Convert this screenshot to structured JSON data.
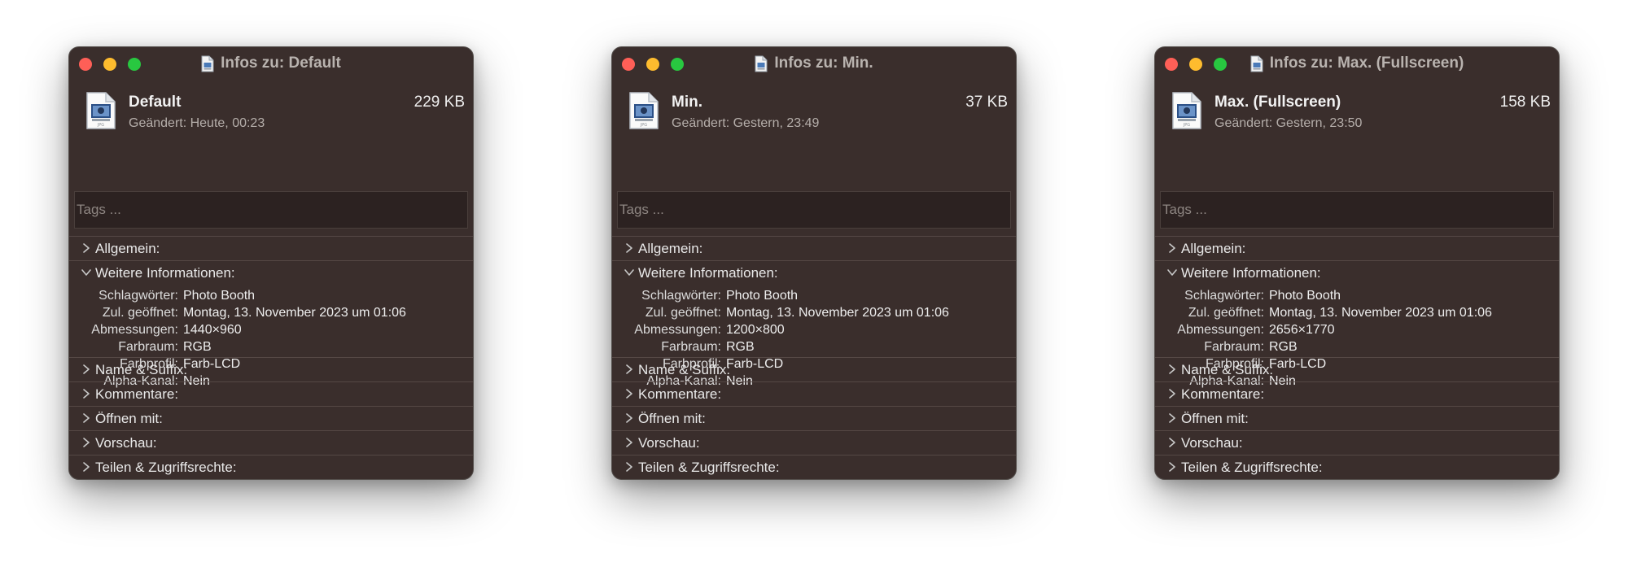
{
  "windows": [
    {
      "title": "Infos zu: Default",
      "file_name": "Default",
      "file_size": "229 KB",
      "modified": "Geändert: Heute, 00:23",
      "icon_caption": "JPG",
      "tags_placeholder": "Tags ...",
      "sections": {
        "general": "Allgemein:",
        "more_info": "Weitere Informationen:",
        "name_suffix": "Name & Suffix:",
        "comments": "Kommentare:",
        "open_with": "Öffnen mit:",
        "preview": "Vorschau:",
        "sharing": "Teilen & Zugriffsrechte:"
      },
      "details": [
        {
          "label": "Schlagwörter:",
          "value": "Photo Booth"
        },
        {
          "label": "Zul. geöffnet:",
          "value": "Montag, 13. November 2023 um 01:06"
        },
        {
          "label": "Abmessungen:",
          "value": "1440×960"
        },
        {
          "label": "Farbraum:",
          "value": "RGB"
        },
        {
          "label": "Farbprofil:",
          "value": "Farb-LCD"
        },
        {
          "label": "Alpha-Kanal:",
          "value": "Nein"
        }
      ]
    },
    {
      "title": "Infos zu: Min.",
      "file_name": "Min.",
      "file_size": "37 KB",
      "modified": "Geändert: Gestern, 23:49",
      "icon_caption": "JPG",
      "tags_placeholder": "Tags ...",
      "sections": {
        "general": "Allgemein:",
        "more_info": "Weitere Informationen:",
        "name_suffix": "Name & Suffix:",
        "comments": "Kommentare:",
        "open_with": "Öffnen mit:",
        "preview": "Vorschau:",
        "sharing": "Teilen & Zugriffsrechte:"
      },
      "details": [
        {
          "label": "Schlagwörter:",
          "value": "Photo Booth"
        },
        {
          "label": "Zul. geöffnet:",
          "value": "Montag, 13. November 2023 um 01:06"
        },
        {
          "label": "Abmessungen:",
          "value": "1200×800"
        },
        {
          "label": "Farbraum:",
          "value": "RGB"
        },
        {
          "label": "Farbprofil:",
          "value": "Farb-LCD"
        },
        {
          "label": "Alpha-Kanal:",
          "value": "Nein"
        }
      ]
    },
    {
      "title": "Infos zu: Max. (Fullscreen)",
      "file_name": "Max. (Fullscreen)",
      "file_size": "158 KB",
      "modified": "Geändert: Gestern, 23:50",
      "icon_caption": "JPG",
      "tags_placeholder": "Tags ...",
      "sections": {
        "general": "Allgemein:",
        "more_info": "Weitere Informationen:",
        "name_suffix": "Name & Suffix:",
        "comments": "Kommentare:",
        "open_with": "Öffnen mit:",
        "preview": "Vorschau:",
        "sharing": "Teilen & Zugriffsrechte:"
      },
      "details": [
        {
          "label": "Schlagwörter:",
          "value": "Photo Booth"
        },
        {
          "label": "Zul. geöffnet:",
          "value": "Montag, 13. November 2023 um 01:06"
        },
        {
          "label": "Abmessungen:",
          "value": "2656×1770"
        },
        {
          "label": "Farbraum:",
          "value": "RGB"
        },
        {
          "label": "Farbprofil:",
          "value": "Farb-LCD"
        },
        {
          "label": "Alpha-Kanal:",
          "value": "Nein"
        }
      ]
    }
  ],
  "colors": {
    "window_bg": "#3a2e2c",
    "close": "#fe5f57",
    "minimize": "#febc2e",
    "zoom": "#28c840"
  },
  "icons": {
    "close": "close-button-icon",
    "minimize": "minimize-button-icon",
    "zoom": "zoom-button-icon",
    "file": "jpg-file-icon",
    "disclosure_collapsed": "chevron-right-icon",
    "disclosure_expanded": "chevron-down-icon"
  }
}
